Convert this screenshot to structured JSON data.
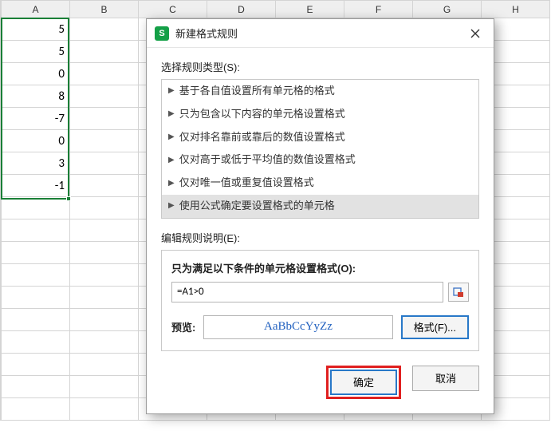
{
  "columns": [
    "A",
    "B",
    "C",
    "D",
    "E",
    "F",
    "G",
    "H"
  ],
  "cells": {
    "colA": [
      "5",
      "5",
      "0",
      "8",
      "-7",
      "0",
      "3",
      "-1"
    ]
  },
  "dialog": {
    "title": "新建格式规则",
    "app_icon_letter": "S",
    "section_type_label": "选择规则类型(S):",
    "rule_types": [
      "基于各自值设置所有单元格的格式",
      "只为包含以下内容的单元格设置格式",
      "仅对排名靠前或靠后的数值设置格式",
      "仅对高于或低于平均值的数值设置格式",
      "仅对唯一值或重复值设置格式",
      "使用公式确定要设置格式的单元格"
    ],
    "selected_rule_index": 5,
    "edit_label": "编辑规则说明(E):",
    "condition_label": "只为满足以下条件的单元格设置格式(O):",
    "formula_value": "=A1>0",
    "preview_label": "预览:",
    "preview_sample": "AaBbCcYyZz",
    "format_button": "格式(F)...",
    "ok": "确定",
    "cancel": "取消"
  }
}
